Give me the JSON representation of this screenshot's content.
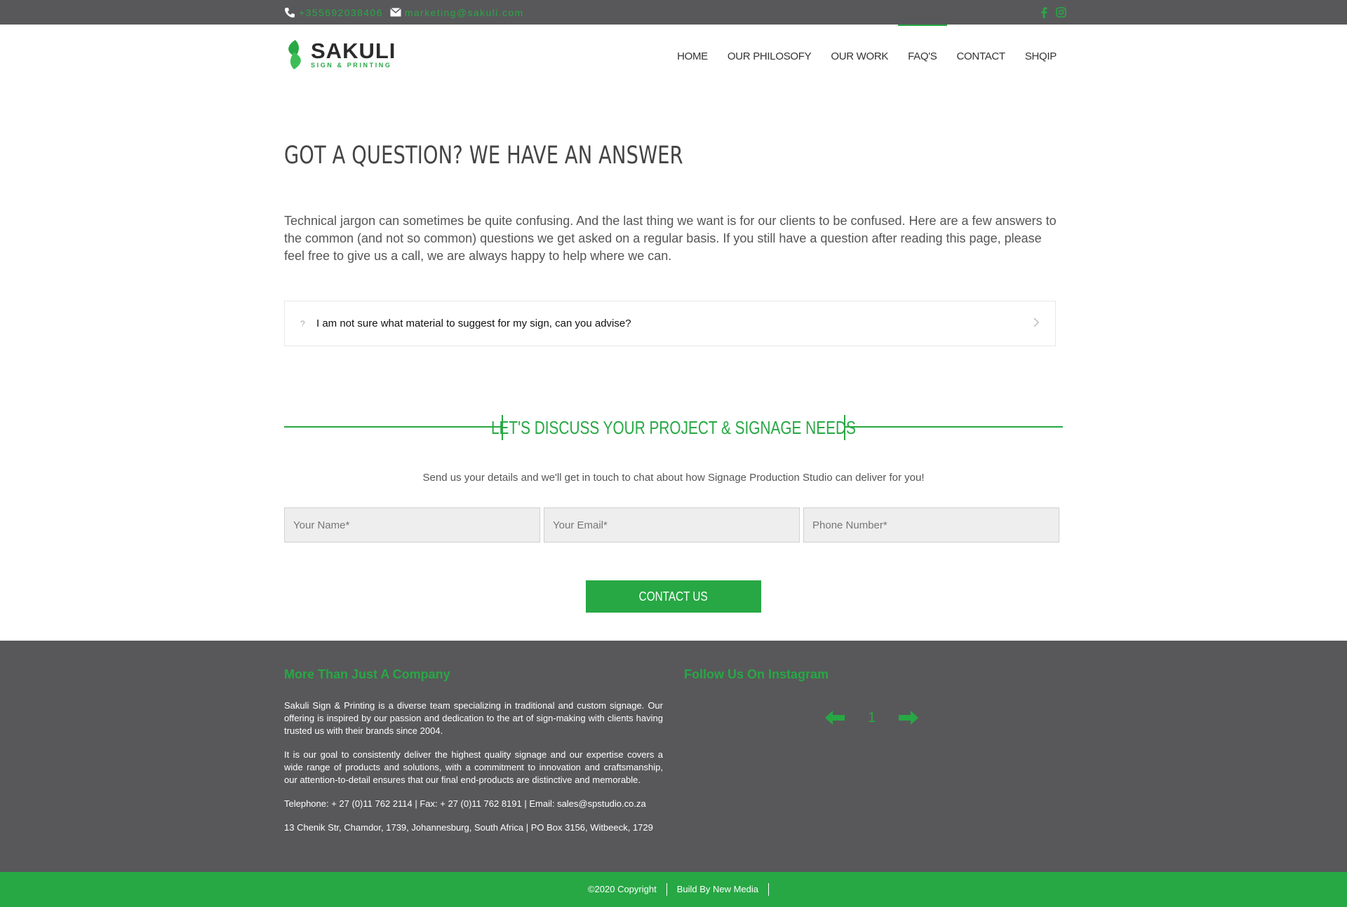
{
  "topbar": {
    "phone": "+355692038406",
    "email": "marketing@sakuli.com",
    "social": [
      "facebook-icon",
      "instagram-icon"
    ]
  },
  "brand": {
    "name": "SAKULI",
    "tagline": "SIGN & PRINTING"
  },
  "nav": {
    "items": [
      {
        "label": "HOME",
        "active": false
      },
      {
        "label": "OUR PHILOSOFY",
        "active": false
      },
      {
        "label": "OUR WORK",
        "active": false
      },
      {
        "label": "FAQ'S",
        "active": true
      },
      {
        "label": "CONTACT",
        "active": false
      },
      {
        "label": "SHQIP",
        "active": false
      }
    ]
  },
  "main": {
    "title": "GOT A QUESTION? WE HAVE AN ANSWER",
    "intro": "Technical jargon can sometimes be quite confusing. And the last thing we want is for our clients to be confused. Here are a few answers to the common (and not so common) questions we get asked on a regular basis. If you still have a question after reading this page, please feel free to give us a call, we are always happy to help where we can.",
    "faq": {
      "mark": "?",
      "question": "I am not sure what material to suggest for my sign, can you advise?"
    }
  },
  "cta": {
    "title": "LET'S DISCUSS YOUR PROJECT & SIGNAGE NEEDS",
    "subtitle": "Send us your details and we'll get in touch to chat about how Signage Production Studio can deliver for you!",
    "name_placeholder": "Your Name*",
    "email_placeholder": "Your Email*",
    "phone_placeholder": "Phone Number*",
    "button": "CONTACT US"
  },
  "footer": {
    "about_heading": "More Than Just A Company",
    "about_p1": "Sakuli Sign & Printing is a diverse team specializing in traditional and custom signage. Our offering is inspired by our passion and dedication to the art of sign-making with clients having trusted us with their brands since 2004.",
    "about_p2": "It is our goal to consistently deliver the highest quality signage and our expertise covers a wide range of products and solutions, with a commitment to innovation and craftsmanship, our attention-to-detail ensures that our final end-products are distinctive and memorable.",
    "contact_line": "Telephone: + 27 (0)11 762 2114 | Fax: + 27 (0)11 762 8191 | Email: sales@spstudio.co.za",
    "address_line": "13 Chenik Str, Chamdor, 1739, Johannesburg, South Africa | PO Box 3156, Witbeeck, 1729",
    "instagram_heading": "Follow Us On Instagram",
    "instagram_page": "1",
    "copyright": "©2020 Copyright",
    "credit": "Build By New Media"
  },
  "colors": {
    "accent": "#27a844",
    "dark_bar": "#58585a"
  }
}
